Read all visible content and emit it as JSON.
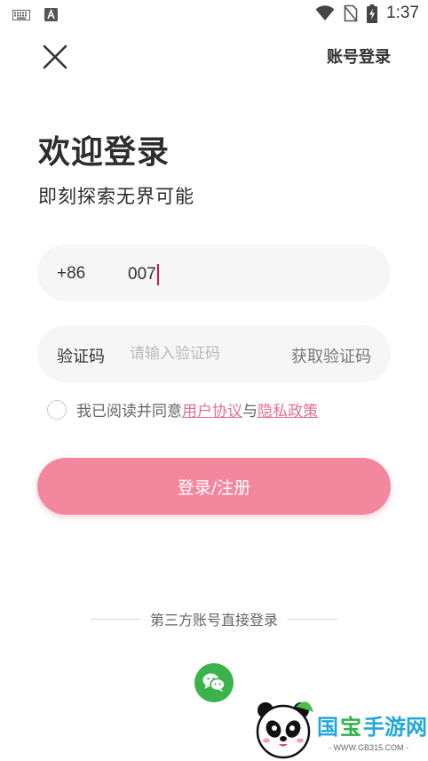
{
  "status_bar": {
    "time": "1:37",
    "icons": [
      "keyboard-icon",
      "font-icon",
      "wifi-icon",
      "no-sim-icon",
      "battery-charging-icon"
    ]
  },
  "top_bar": {
    "close_icon": "close-icon",
    "account_login": "账号登录"
  },
  "welcome": {
    "title": "欢迎登录",
    "subtitle": "即刻探索无界可能"
  },
  "phone_field": {
    "country_code": "+86",
    "value": "007"
  },
  "code_field": {
    "label": "验证码",
    "placeholder": "请输入验证码",
    "get_code": "获取验证码"
  },
  "agreement": {
    "prefix": "我已阅读并同意",
    "user_agreement": "用户协议",
    "conjunction": "与",
    "privacy_policy": "隐私政策"
  },
  "login_button": "登录/注册",
  "third_party": {
    "label": "第三方账号直接登录",
    "wechat_icon": "wechat-icon"
  },
  "watermark": {
    "brand": "国宝手游网",
    "url": "WWW.GB315.COM"
  },
  "colors": {
    "accent": "#f2879e",
    "link": "#e2718b",
    "field_bg": "#f6f6f6",
    "wechat": "#3ab34a",
    "caret": "#d7193d"
  }
}
